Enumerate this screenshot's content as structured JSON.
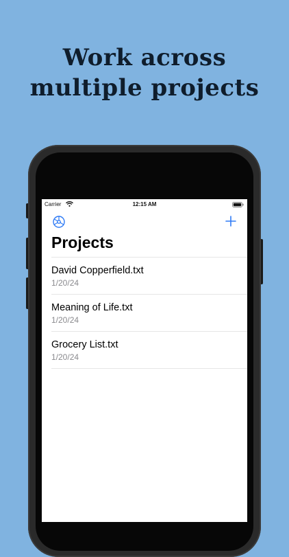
{
  "headline": {
    "line1": "Work across",
    "line2": "multiple projects"
  },
  "status_bar": {
    "carrier": "Carrier",
    "time": "12:15 AM"
  },
  "nav": {
    "settings_icon": "gear-icon",
    "add_icon": "plus-icon",
    "title": "Projects"
  },
  "projects": [
    {
      "name": "David Copperfield.txt",
      "date": "1/20/24"
    },
    {
      "name": "Meaning of Life.txt",
      "date": "1/20/24"
    },
    {
      "name": "Grocery List.txt",
      "date": "1/20/24"
    }
  ],
  "colors": {
    "background": "#80b3e0",
    "accent": "#2f7bf5"
  }
}
